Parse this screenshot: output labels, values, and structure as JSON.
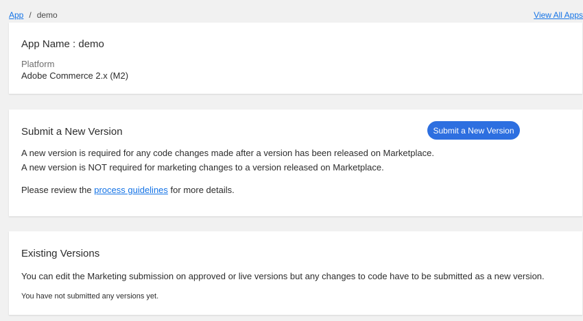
{
  "breadcrumb": {
    "root": "App",
    "separator": "/",
    "current": "demo"
  },
  "header": {
    "view_all_label": "View All Apps"
  },
  "app_card": {
    "app_name": "App Name : demo",
    "platform_label": "Platform",
    "platform_value": "Adobe Commerce 2.x (M2)"
  },
  "submit_card": {
    "title": "Submit a New Version",
    "button_label": "Submit a New Version",
    "line1": "A new version is required for any code changes made after a version has been released on Marketplace.",
    "line2": "A new version is NOT required for marketing changes to a version released on Marketplace.",
    "review_prefix": "Please review the ",
    "review_link": "process guidelines",
    "review_suffix": " for more details."
  },
  "versions_card": {
    "title": "Existing Versions",
    "description": "You can edit the Marketing submission on approved or live versions but any changes to code have to be submitted as a new version.",
    "empty_message": "You have not submitted any versions yet."
  },
  "colors": {
    "background": "#f1f1f1",
    "link": "#1473e6",
    "button": "#2d6fe0"
  }
}
